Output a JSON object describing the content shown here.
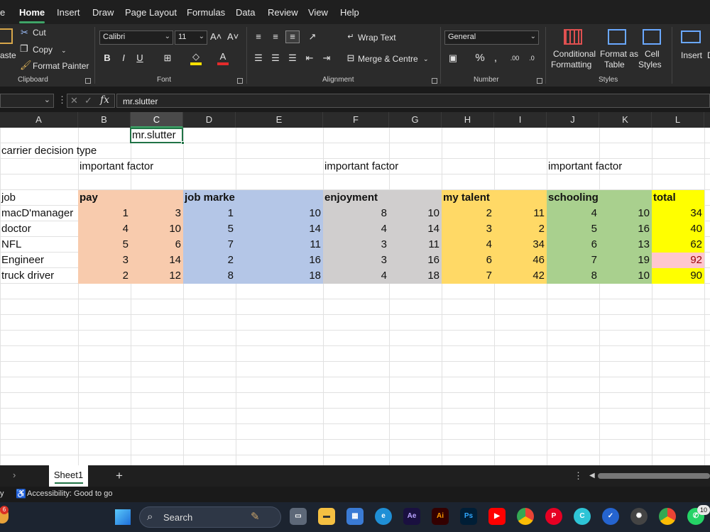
{
  "menu": {
    "items": [
      "e",
      "Home",
      "Insert",
      "Draw",
      "Page Layout",
      "Formulas",
      "Data",
      "Review",
      "View",
      "Help"
    ],
    "active": "Home"
  },
  "ribbon": {
    "clipboard": {
      "paste": "aste",
      "cut": "Cut",
      "copy": "Copy",
      "format_painter": "Format Painter",
      "label": "Clipboard"
    },
    "font": {
      "name": "Calibri",
      "size": "11",
      "label": "Font"
    },
    "alignment": {
      "wrap": "Wrap Text",
      "merge": "Merge & Centre",
      "label": "Alignment"
    },
    "number": {
      "format": "General",
      "label": "Number"
    },
    "styles": {
      "conditional_1": "Conditional",
      "conditional_2": "Formatting",
      "format_table_1": "Format as",
      "format_table_2": "Table",
      "cell_styles_1": "Cell",
      "cell_styles_2": "Styles",
      "label": "Styles"
    },
    "cells": {
      "insert": "Insert",
      "delete": "D"
    }
  },
  "formula_bar": {
    "fx": "fx",
    "value": "mr.slutter"
  },
  "columns": [
    "A",
    "B",
    "C",
    "D",
    "E",
    "F",
    "G",
    "H",
    "I",
    "J",
    "K",
    "L"
  ],
  "selected_column": "C",
  "sheet": {
    "c1": "mr.slutter",
    "a2": "carrier decision type",
    "factor_labels": [
      "important factor",
      "important factor",
      "important factor"
    ],
    "a5": "job",
    "headers": [
      "pay",
      "job marke",
      "enjoyment",
      "my talent",
      "schooling",
      "total"
    ],
    "rows": [
      {
        "job": "macD'manager",
        "values": [
          1,
          3,
          1,
          10,
          8,
          10,
          2,
          11,
          4,
          10,
          34
        ]
      },
      {
        "job": "doctor",
        "values": [
          4,
          10,
          5,
          14,
          4,
          14,
          3,
          2,
          5,
          16,
          40
        ]
      },
      {
        "job": "NFL",
        "values": [
          5,
          6,
          7,
          11,
          3,
          11,
          4,
          34,
          6,
          13,
          62
        ]
      },
      {
        "job": "Engineer",
        "values": [
          3,
          14,
          2,
          16,
          3,
          16,
          6,
          46,
          7,
          19,
          92
        ]
      },
      {
        "job": "truck driver",
        "values": [
          2,
          12,
          8,
          18,
          4,
          18,
          7,
          42,
          8,
          10,
          90
        ]
      }
    ],
    "colors": {
      "pay": "#f8cbad",
      "job_market": "#b4c6e7",
      "enjoyment": "#d0cece",
      "talent": "#ffd966",
      "schooling": "#a9d08e",
      "total": "#ffff00",
      "highlight": "#ffc7ce",
      "highlight_text": "#9c0006"
    }
  },
  "tabs": {
    "sheet1": "Sheet1",
    "add": "+"
  },
  "status": {
    "left": "y",
    "accessibility": "Accessibility: Good to go"
  },
  "taskbar": {
    "search": "Search",
    "badge_left": "6",
    "badge_right": "10"
  }
}
